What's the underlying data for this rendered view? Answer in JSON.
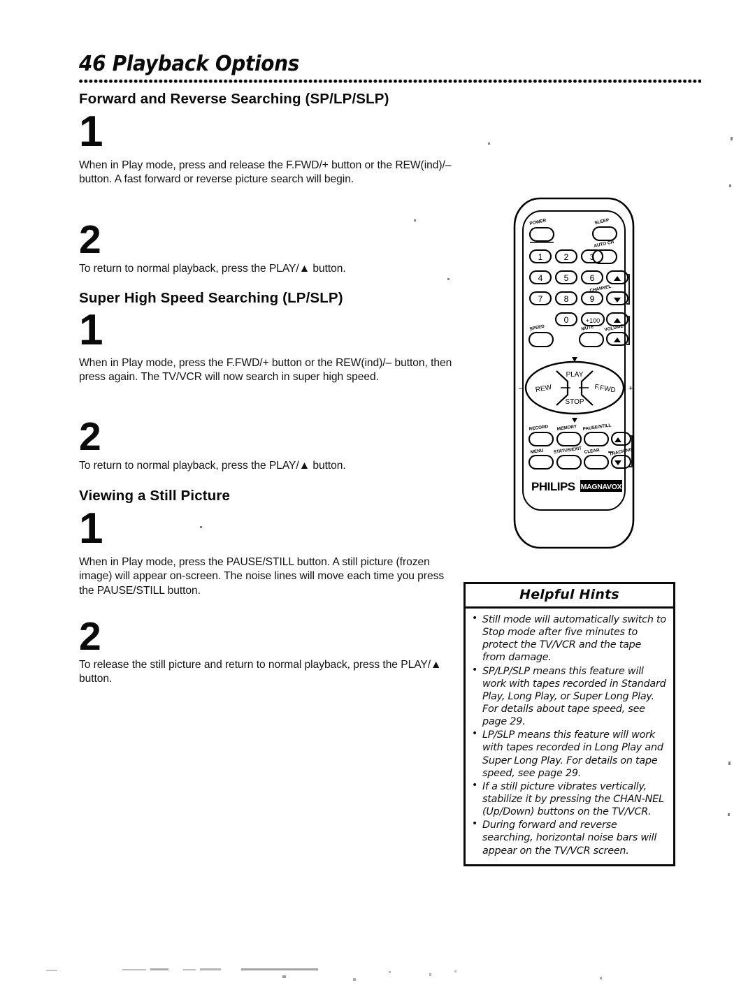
{
  "header": {
    "page_number": "46",
    "title": "Playback Options"
  },
  "sections": [
    {
      "heading": "Forward and Reverse Searching (SP/LP/SLP)",
      "steps": [
        {
          "number": "1",
          "text": "When in Play mode, press and release the F.FWD/+ button or the REW(ind)/– button. A fast forward or reverse picture search will begin."
        },
        {
          "number": "2",
          "text": "To return to normal playback, press the PLAY/▲ button."
        }
      ]
    },
    {
      "heading": "Super High Speed Searching (LP/SLP)",
      "steps": [
        {
          "number": "1",
          "text": "When in Play mode, press the F.FWD/+ button or the REW(ind)/– button, then press again. The TV/VCR will now search in super high speed."
        },
        {
          "number": "2",
          "text": "To return to normal playback, press the PLAY/▲ button."
        }
      ]
    },
    {
      "heading": "Viewing a Still Picture",
      "steps": [
        {
          "number": "1",
          "text": "When in Play mode, press the PAUSE/STILL button. A still picture (frozen image) will appear on-screen. The noise lines will move each time you press the PAUSE/STILL button."
        },
        {
          "number": "2",
          "text": "To release the still picture and return to normal playback, press the PLAY/▲ button."
        }
      ]
    }
  ],
  "hints": {
    "title": "Helpful Hints",
    "items": [
      "Still mode will automatically switch to Stop mode after five minutes to protect the TV/VCR and the tape from damage.",
      "SP/LP/SLP means this feature will work with tapes recorded in Standard Play, Long Play, or Super Long Play.  For details about tape speed, see page 29.",
      "LP/SLP means this feature will work with tapes recorded in Long Play and Super Long Play.  For details on tape speed, see page 29.",
      "If a still picture vibrates vertically, stabilize it by pressing the CHAN-NEL  (Up/Down) buttons on the TV/VCR.",
      "During forward and reverse searching, horizontal noise bars will appear on the TV/VCR screen."
    ]
  },
  "remote": {
    "brand": "PHILIPS",
    "sub_brand": "MAGNAVOX",
    "buttons": {
      "power": "POWER",
      "sleep": "SLEEP",
      "auto_ch": "AUTO CH",
      "speed": "SPEED",
      "mute": "MUTE",
      "channel": "CHANNEL",
      "volume": "VOLUME",
      "tracking": "TRACKING",
      "plus_hundred": "+100",
      "play": "PLAY",
      "rew": "REW",
      "ffwd": "F.FWD",
      "stop": "STOP",
      "minus": "–",
      "plus": "+",
      "record": "RECORD",
      "memory": "MEMORY",
      "pause_still": "PAUSE/STILL",
      "menu": "MENU",
      "status_exit": "STATUS/EXIT",
      "clear": "CLEAR"
    },
    "keypad": [
      "1",
      "2",
      "3",
      "4",
      "5",
      "6",
      "7",
      "8",
      "9",
      "0"
    ]
  }
}
